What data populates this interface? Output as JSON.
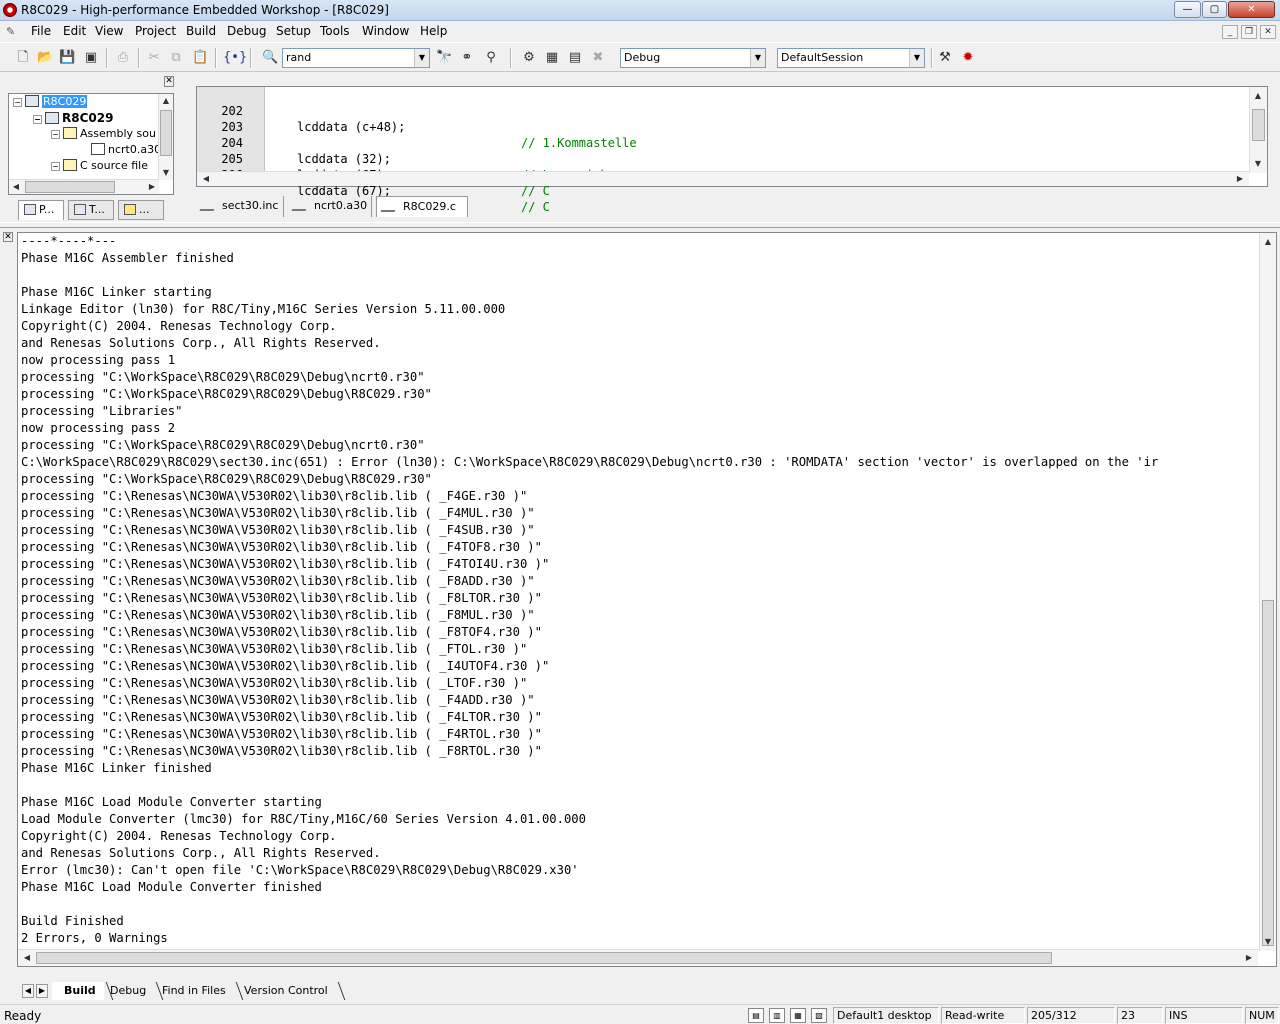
{
  "window": {
    "title": "R8C029 - High-performance Embedded Workshop - [R8C029]",
    "buttons": {
      "minimize": "—",
      "maximize": "▢",
      "close": "✕"
    }
  },
  "menu": {
    "items": [
      "File",
      "Edit",
      "View",
      "Project",
      "Build",
      "Debug",
      "Setup",
      "Tools",
      "Window",
      "Help"
    ],
    "mdi_buttons": {
      "minimize": "_",
      "restore": "❐",
      "close": "✕"
    }
  },
  "toolbar": {
    "find_value": "rand",
    "config_value": "Debug",
    "session_value": "DefaultSession",
    "icons": [
      "new-file-icon",
      "open-icon",
      "save-icon",
      "save-all-icon",
      "print-icon",
      "cut-icon",
      "copy-icon",
      "paste-icon",
      "navigate-icon",
      "find-icon",
      "find-next-icon",
      "replace-icon",
      "find-in-files-icon",
      "build-file-icon",
      "build-icon",
      "build-all-icon",
      "stop-build-icon",
      "debug-settings-icon",
      "connect-icon"
    ]
  },
  "workspace": {
    "close": "✕",
    "tree": [
      {
        "label": "R8C029",
        "level": 0,
        "kind": "workspace",
        "expander": "−",
        "selected": true
      },
      {
        "label": "R8C029",
        "level": 1,
        "kind": "project",
        "expander": "−",
        "bold": true
      },
      {
        "label": "Assembly sou",
        "level": 2,
        "kind": "folder",
        "expander": "−"
      },
      {
        "label": "ncrt0.a30",
        "level": 3,
        "kind": "file",
        "expander": ""
      },
      {
        "label": "C source file",
        "level": 2,
        "kind": "folder",
        "expander": "−"
      }
    ],
    "tabs": [
      {
        "label": "P...",
        "active": true
      },
      {
        "label": "T...",
        "active": false
      },
      {
        "label": "...",
        "active": false
      }
    ]
  },
  "editor": {
    "lines": [
      {
        "num": "202",
        "code": "lcddata (c+48);",
        "comment": "// 1.Kommastelle"
      },
      {
        "num": "203",
        "code": "",
        "comment": ""
      },
      {
        "num": "204",
        "code": "lcddata (32);",
        "comment": "// Leerzeichen"
      },
      {
        "num": "205",
        "code": "lcddata (67);",
        "comment": "// C"
      },
      {
        "num": "206",
        "code": "lcddata (67);",
        "comment": "// C"
      }
    ],
    "tabs": [
      {
        "label": "sect30.inc",
        "active": false
      },
      {
        "label": "ncrt0.a30",
        "active": false
      },
      {
        "label": "R8C029.c",
        "active": true
      }
    ]
  },
  "output": {
    "close": "✕",
    "lines": [
      "----*----*---",
      "Phase M16C Assembler finished",
      "",
      "Phase M16C Linker starting",
      "Linkage Editor (ln30) for R8C/Tiny,M16C Series Version 5.11.00.000",
      "Copyright(C) 2004. Renesas Technology Corp.",
      "and Renesas Solutions Corp., All Rights Reserved.",
      "now processing pass 1",
      "processing \"C:\\WorkSpace\\R8C029\\R8C029\\Debug\\ncrt0.r30\"",
      "processing \"C:\\WorkSpace\\R8C029\\R8C029\\Debug\\R8C029.r30\"",
      "processing \"Libraries\"",
      "now processing pass 2",
      "processing \"C:\\WorkSpace\\R8C029\\R8C029\\Debug\\ncrt0.r30\"",
      "C:\\WorkSpace\\R8C029\\R8C029\\sect30.inc(651) : Error (ln30): C:\\WorkSpace\\R8C029\\R8C029\\Debug\\ncrt0.r30 : 'ROMDATA' section 'vector' is overlapped on the 'ir",
      "processing \"C:\\WorkSpace\\R8C029\\R8C029\\Debug\\R8C029.r30\"",
      "processing \"C:\\Renesas\\NC30WA\\V530R02\\lib30\\r8clib.lib ( _F4GE.r30 )\"",
      "processing \"C:\\Renesas\\NC30WA\\V530R02\\lib30\\r8clib.lib ( _F4MUL.r30 )\"",
      "processing \"C:\\Renesas\\NC30WA\\V530R02\\lib30\\r8clib.lib ( _F4SUB.r30 )\"",
      "processing \"C:\\Renesas\\NC30WA\\V530R02\\lib30\\r8clib.lib ( _F4TOF8.r30 )\"",
      "processing \"C:\\Renesas\\NC30WA\\V530R02\\lib30\\r8clib.lib ( _F4TOI4U.r30 )\"",
      "processing \"C:\\Renesas\\NC30WA\\V530R02\\lib30\\r8clib.lib ( _F8ADD.r30 )\"",
      "processing \"C:\\Renesas\\NC30WA\\V530R02\\lib30\\r8clib.lib ( _F8LTOR.r30 )\"",
      "processing \"C:\\Renesas\\NC30WA\\V530R02\\lib30\\r8clib.lib ( _F8MUL.r30 )\"",
      "processing \"C:\\Renesas\\NC30WA\\V530R02\\lib30\\r8clib.lib ( _F8TOF4.r30 )\"",
      "processing \"C:\\Renesas\\NC30WA\\V530R02\\lib30\\r8clib.lib ( _FTOL.r30 )\"",
      "processing \"C:\\Renesas\\NC30WA\\V530R02\\lib30\\r8clib.lib ( _I4UTOF4.r30 )\"",
      "processing \"C:\\Renesas\\NC30WA\\V530R02\\lib30\\r8clib.lib ( _LTOF.r30 )\"",
      "processing \"C:\\Renesas\\NC30WA\\V530R02\\lib30\\r8clib.lib ( _F4ADD.r30 )\"",
      "processing \"C:\\Renesas\\NC30WA\\V530R02\\lib30\\r8clib.lib ( _F4LTOR.r30 )\"",
      "processing \"C:\\Renesas\\NC30WA\\V530R02\\lib30\\r8clib.lib ( _F4RTOL.r30 )\"",
      "processing \"C:\\Renesas\\NC30WA\\V530R02\\lib30\\r8clib.lib ( _F8RTOL.r30 )\"",
      "Phase M16C Linker finished",
      "",
      "Phase M16C Load Module Converter starting",
      "Load Module Converter (lmc30) for R8C/Tiny,M16C/60 Series Version 4.01.00.000",
      "Copyright(C) 2004. Renesas Technology Corp.",
      "and Renesas Solutions Corp., All Rights Reserved.",
      "Error (lmc30): Can't open file 'C:\\WorkSpace\\R8C029\\R8C029\\Debug\\R8C029.x30'",
      "Phase M16C Load Module Converter finished",
      "",
      "Build Finished",
      "2 Errors, 0 Warnings"
    ],
    "tabs": [
      {
        "label": "Build",
        "active": true
      },
      {
        "label": "Debug",
        "active": false
      },
      {
        "label": "Find in Files",
        "active": false
      },
      {
        "label": "Version Control",
        "active": false
      }
    ]
  },
  "status": {
    "ready": "Ready",
    "desktop": "Default1 desktop",
    "mode": "Read-write",
    "line": "205/312",
    "column": "23",
    "ins": "INS",
    "num": "NUM"
  }
}
